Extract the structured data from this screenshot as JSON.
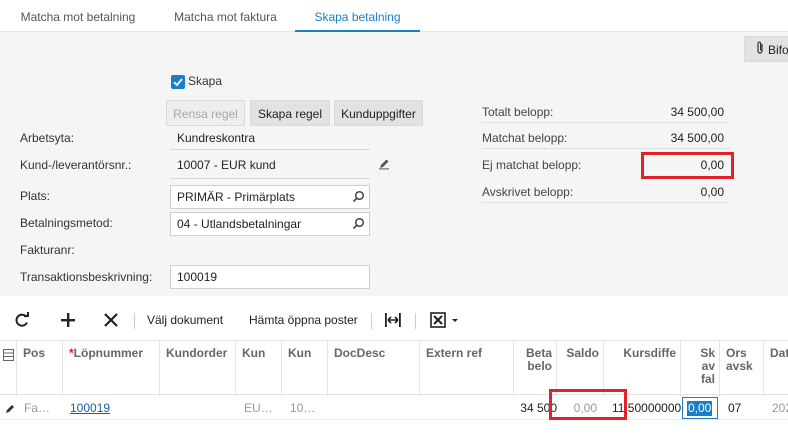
{
  "tabs": [
    {
      "label": "Matcha mot betalning"
    },
    {
      "label": "Matcha mot faktura"
    },
    {
      "label": "Skapa betalning"
    }
  ],
  "header": {
    "attach_button": "Bifo"
  },
  "form": {
    "create_checkbox_label": "Skapa",
    "create_checked": true,
    "buttons": {
      "clear_rule": "Rensa regel",
      "create_rule": "Skapa regel",
      "customer_fees": "Kunduppgifter"
    },
    "workspace_label": "Arbetsyta:",
    "workspace_value": "Kundreskontra",
    "customer_label": "Kund-/leverantörsnr.:",
    "customer_value": "10007 - EUR kund",
    "location_label": "Plats:",
    "location_value": "PRIMÄR - Primärplats",
    "payment_method_label": "Betalningsmetod:",
    "payment_method_value": "04 - Utlandsbetalningar",
    "invoice_label": "Fakturanr:",
    "transaction_label": "Transaktionsbeskrivning:",
    "transaction_value": "100019"
  },
  "amounts": {
    "total_label": "Totalt belopp:",
    "total_value": "34 500,00",
    "matched_label": "Matchat belopp:",
    "matched_value": "34 500,00",
    "unmatched_label": "Ej matchat belopp:",
    "unmatched_value": "0,00",
    "written_off_label": "Avskrivet belopp:",
    "written_off_value": "0,00"
  },
  "toolbar": {
    "select_document": "Välj dokument",
    "fetch_open": "Hämta öppna poster"
  },
  "grid": {
    "columns": {
      "pos": "Pos",
      "required_mark": "*",
      "line_number": "Löpnummer",
      "customer_order": "Kundorder",
      "customer": "Kun",
      "customer2": "Kun",
      "doc_desc": "DocDesc",
      "external_ref": "Extern ref",
      "payment_amount": "Beta belo",
      "balance": "Saldo",
      "rate_diff": "Kursdiffe",
      "writeoff": "Sk av fal",
      "reason": "Ors avsk",
      "date": "Dat"
    },
    "row": {
      "pos": "Fa…",
      "line_number": "100019",
      "customer": "EU…",
      "customer2": "10…",
      "payment_amount": "34 500",
      "balance": "0,00",
      "rate_diff": "11,50000000",
      "writeoff": "0,00",
      "reason": "07",
      "date": "202"
    }
  }
}
